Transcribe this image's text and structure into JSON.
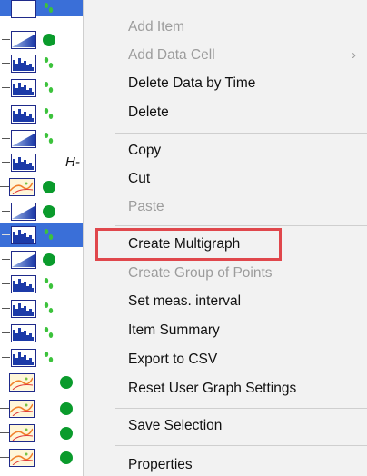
{
  "context_menu": {
    "items": [
      {
        "label": "Add Item",
        "enabled": false
      },
      {
        "label": "Add Data Cell",
        "enabled": false,
        "submenu_arrow": "›"
      },
      {
        "label": "Delete Data by Time",
        "enabled": true
      },
      {
        "label": "Delete",
        "enabled": true
      },
      {
        "label": "Copy",
        "enabled": true
      },
      {
        "label": "Cut",
        "enabled": true
      },
      {
        "label": "Paste",
        "enabled": false
      },
      {
        "label": "Create Multigraph",
        "enabled": true,
        "highlighted": true
      },
      {
        "label": "Create Group of Points",
        "enabled": false
      },
      {
        "label": "Set meas. interval",
        "enabled": true
      },
      {
        "label": "Item Summary",
        "enabled": true
      },
      {
        "label": "Export to CSV",
        "enabled": true
      },
      {
        "label": "Reset User Graph Settings",
        "enabled": true
      },
      {
        "label": "Save Selection",
        "enabled": true
      },
      {
        "label": "Properties",
        "enabled": true
      }
    ],
    "highlight_color": "#e0474c",
    "background": "#f2f2f2",
    "disabled_text_color": "#9c9c9c"
  },
  "tree": {
    "selection_color": "#3a6fd8",
    "status_green": "#0a9b2c",
    "partial_label": "H-"
  }
}
